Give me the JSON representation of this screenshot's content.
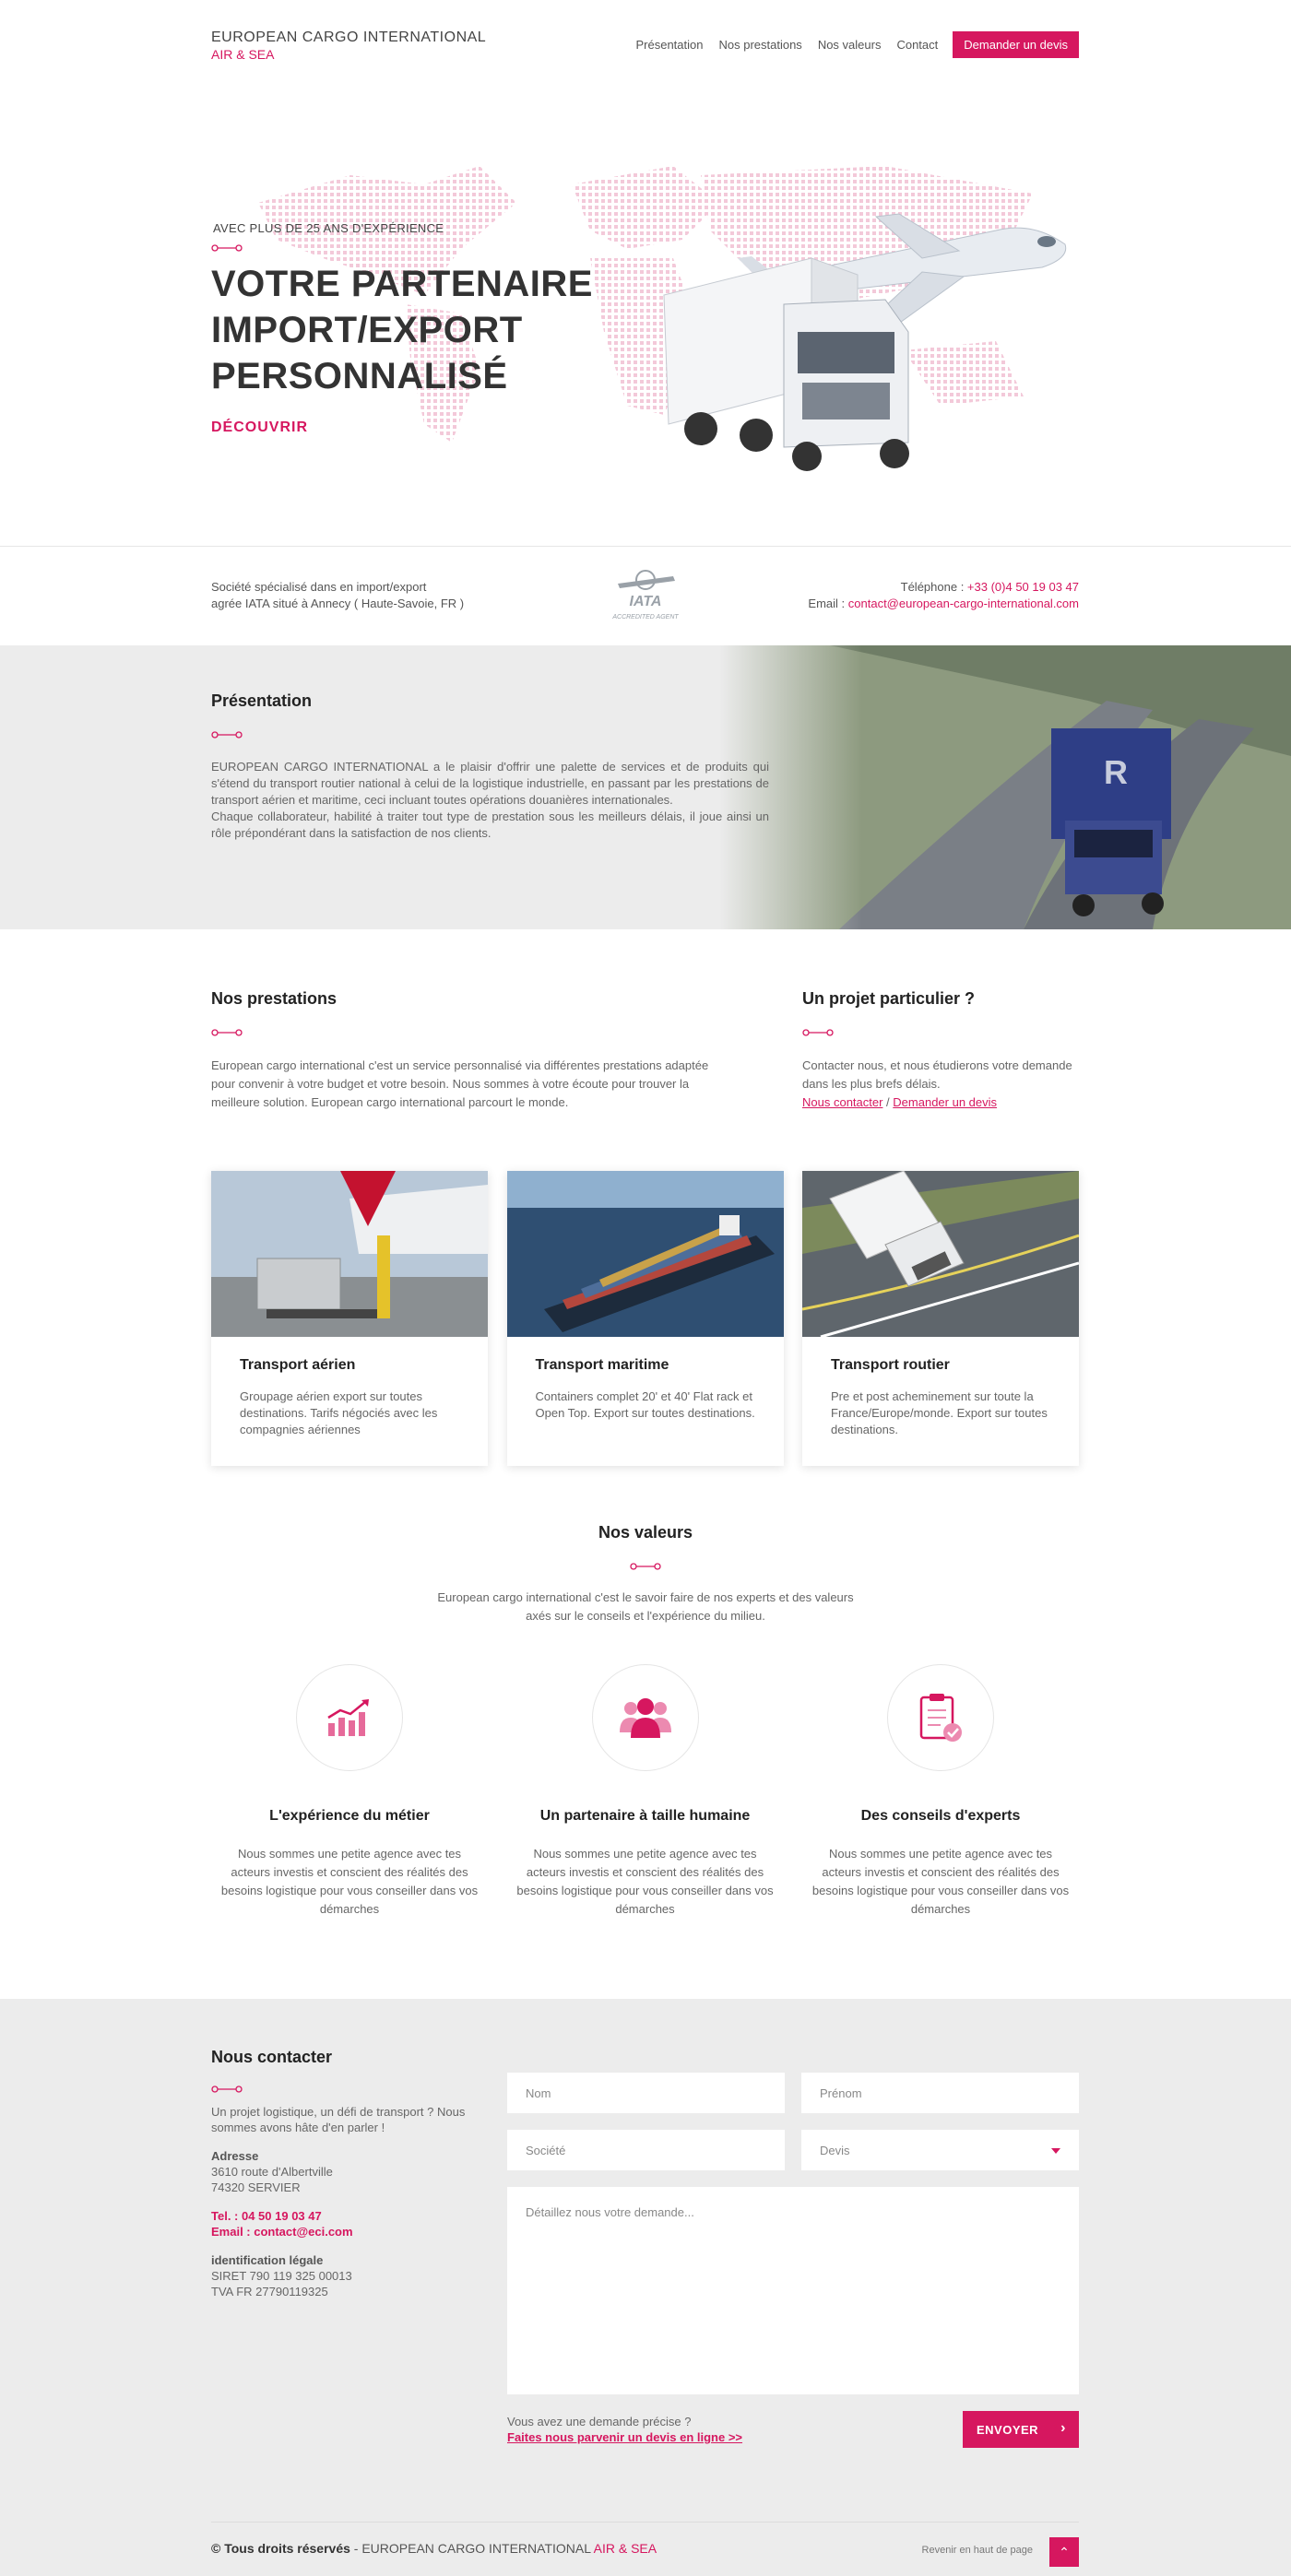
{
  "header": {
    "logo_line1": "EUROPEAN CARGO INTERNATIONAL",
    "logo_line2": "AIR & SEA",
    "nav": [
      "Présentation",
      "Nos prestations",
      "Nos valeurs",
      "Contact"
    ],
    "cta": "Demander un devis"
  },
  "hero": {
    "eyebrow": "AVEC PLUS DE 25 ANS D'EXPÉRIENCE",
    "title_l1": "VOTRE PARTENAIRE",
    "title_l2": "IMPORT/EXPORT",
    "title_l3": "PERSONNALISÉ",
    "cta": "DÉCOUVRIR"
  },
  "info": {
    "desc_l1": "Société spécialisé dans en import/export",
    "desc_l2": "agrée IATA situé à Annecy ( Haute-Savoie, FR )",
    "iata_text": "IATA",
    "iata_sub": "ACCREDITED AGENT",
    "phone_label": "Téléphone : ",
    "phone": "+33 (0)4 50 19 03 47",
    "email_label": "Email : ",
    "email": "contact@european-cargo-international.com"
  },
  "presentation": {
    "title": "Présentation",
    "p1": "EUROPEAN CARGO INTERNATIONAL a le plaisir d'offrir une palette de services et de produits qui s'étend du transport routier national à celui de la logistique industrielle, en passant par les prestations de transport aérien et maritime, ceci incluant toutes opérations douanières internationales.",
    "p2": "Chaque collaborateur, habilité à traiter tout type de prestation sous les meilleurs délais, il joue ainsi un rôle prépondérant dans la satisfaction de nos clients."
  },
  "services": {
    "title": "Nos prestations",
    "text": "European cargo international c'est un service personnalisé via différentes prestations adaptée pour convenir à votre budget et votre besoin. Nous sommes à votre écoute pour trouver la meilleure solution. European cargo international parcourt le monde.",
    "project_title": "Un projet particulier ?",
    "project_text": "Contacter nous, et nous étudierons votre demande dans les plus brefs délais.",
    "link_contact": "Nous contacter",
    "link_sep": " / ",
    "link_devis": "Demander un devis",
    "cards": [
      {
        "title": "Transport aérien",
        "text": "Groupage aérien export sur toutes destinations. Tarifs négociés avec les compagnies aériennes"
      },
      {
        "title": "Transport maritime",
        "text": "Containers complet 20' et 40' Flat rack et Open Top. Export sur toutes destinations."
      },
      {
        "title": "Transport routier",
        "text": "Pre et post acheminement sur toute la France/Europe/monde. Export sur toutes destinations."
      }
    ]
  },
  "values": {
    "title": "Nos valeurs",
    "text": "European cargo international c'est le savoir faire de nos experts et des valeurs axés sur le conseils et l'expérience du milieu.",
    "items": [
      {
        "title": "L'expérience du métier",
        "text": "Nous sommes une petite agence avec tes acteurs investis et conscient des réalités des besoins logistique pour vous conseiller dans vos démarches",
        "icon": "growth-chart-icon"
      },
      {
        "title": "Un partenaire à taille humaine",
        "text": "Nous sommes une petite agence avec tes acteurs investis et conscient des réalités des besoins logistique pour vous conseiller dans vos démarches",
        "icon": "team-icon"
      },
      {
        "title": "Des conseils d'experts",
        "text": "Nous sommes une petite agence avec tes acteurs investis et conscient des réalités des besoins logistique pour vous conseiller dans vos démarches",
        "icon": "clipboard-check-icon"
      }
    ]
  },
  "contact": {
    "title": "Nous contacter",
    "intro": "Un projet logistique, un défi de transport ? Nous sommes avons hâte d'en parler !",
    "addr_label": "Adresse",
    "addr_l1": "3610 route d'Albertville",
    "addr_l2": "74320 SERVIER",
    "tel": "Tel. : 04 50 19 03 47",
    "email": "Email : contact@eci.com",
    "legal_label": "identification légale",
    "siret": "SIRET 790 119 325 00013",
    "tva": "TVA FR 27790119325",
    "form": {
      "nom": "Nom",
      "prenom": "Prénom",
      "societe": "Société",
      "devis": "Devis",
      "message": "Détaillez nous votre demande...",
      "foot_l1": "Vous avez une demande précise ?",
      "foot_link": "Faites nous parvenir un devis en ligne >>",
      "send": "ENVOYER"
    }
  },
  "footer": {
    "copy_bold": "© Tous droits réservés",
    "copy_sep": " - ",
    "copy_name": "EUROPEAN CARGO INTERNATIONAL ",
    "copy_accent": "AIR & SEA",
    "back_top": "Revenir en haut de page"
  },
  "colors": {
    "accent": "#d6175f",
    "gray_bg": "#ececec",
    "text": "#555555"
  }
}
